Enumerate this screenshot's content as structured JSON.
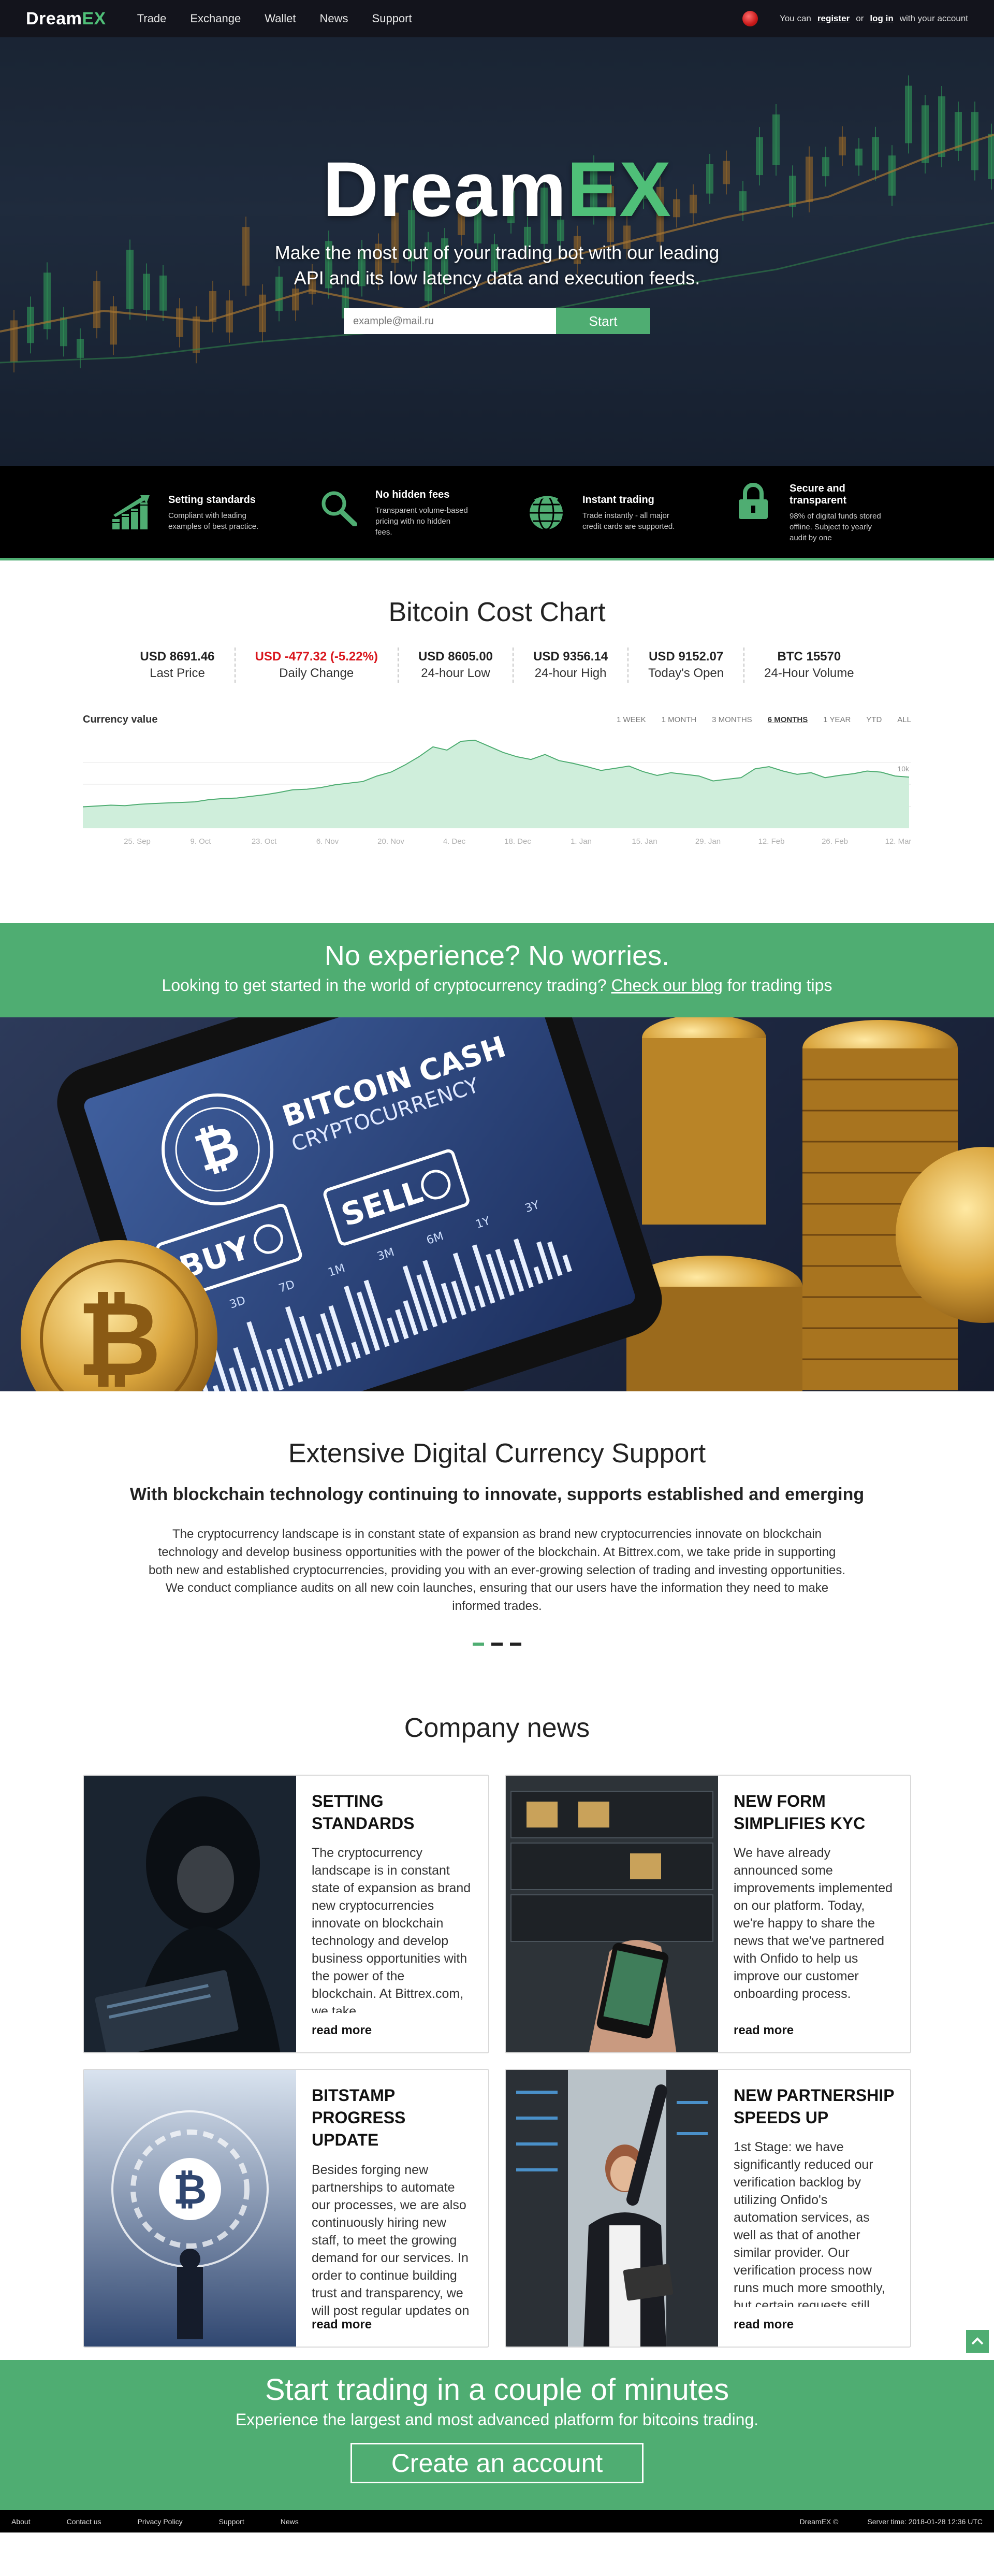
{
  "nav": {
    "logo_main": "Dream",
    "logo_accent": "EX",
    "links": [
      "Trade",
      "Exchange",
      "Wallet",
      "News",
      "Support"
    ],
    "account_prefix": "You can",
    "register": "register",
    "or": "or",
    "login": "log in",
    "account_suffix": "with your account"
  },
  "hero": {
    "title_main": "Dream",
    "title_accent": "EX",
    "subtitle_line1": "Make the most out of your trading bot with our leading",
    "subtitle_line2": "API and its low latency data and execution feeds.",
    "email_placeholder": "example@mail.ru",
    "start_label": "Start"
  },
  "features": [
    {
      "icon": "bar-chart-icon",
      "title": "Setting standards",
      "desc": "Compliant with leading examples of best practice."
    },
    {
      "icon": "search-icon",
      "title": "No hidden fees",
      "desc": "Transparent volume-based pricing with no hidden fees."
    },
    {
      "icon": "globe-icon",
      "title": "Instant trading",
      "desc": "Trade instantly - all major credit cards are supported."
    },
    {
      "icon": "lock-icon",
      "title": "Secure and transparent",
      "desc": "98% of digital funds stored offline. Subject to yearly audit by one"
    }
  ],
  "cost": {
    "title": "Bitcoin Cost Chart",
    "stats": [
      {
        "value": "USD 8691.46",
        "label": "Last Price",
        "negative": false
      },
      {
        "value": "USD -477.32 (-5.22%)",
        "label": "Daily Change",
        "negative": true
      },
      {
        "value": "USD 8605.00",
        "label": "24-hour Low",
        "negative": false
      },
      {
        "value": "USD 9356.14",
        "label": "24-hour High",
        "negative": false
      },
      {
        "value": "USD 9152.07",
        "label": "Today's Open",
        "negative": false
      },
      {
        "value": "BTC 15570",
        "label": "24-Hour Volume",
        "negative": false
      }
    ],
    "chart_title": "Currency value",
    "ranges": [
      "1 WEEK",
      "1 MONTH",
      "3 MONTHS",
      "6 MONTHS",
      "1 YEAR",
      "YTD",
      "ALL"
    ],
    "active_range": "6 MONTHS"
  },
  "chart_data": {
    "type": "area",
    "title": "Currency value",
    "xlabel": "",
    "ylabel": "",
    "x_ticks": [
      "25. Sep",
      "9. Oct",
      "23. Oct",
      "6. Nov",
      "20. Nov",
      "4. Dec",
      "18. Dec",
      "1. Jan",
      "15. Jan",
      "29. Jan",
      "12. Feb",
      "26. Feb",
      "12. Mar"
    ],
    "y_ticks": [
      "10k"
    ],
    "ylim": [
      0,
      16000
    ],
    "values": [
      3900,
      4050,
      4200,
      4100,
      4350,
      4500,
      4600,
      4700,
      4800,
      5200,
      5400,
      5500,
      5800,
      6100,
      6500,
      7000,
      7100,
      7400,
      7900,
      8200,
      8500,
      9500,
      10200,
      11500,
      13000,
      14800,
      14200,
      15800,
      16000,
      14900,
      13800,
      13000,
      12500,
      13400,
      12300,
      11800,
      11200,
      10500,
      10900,
      11300,
      10300,
      9600,
      10100,
      9800,
      9500,
      8600,
      8900,
      9200,
      10800,
      11200,
      10400,
      9800,
      10100,
      9200,
      9600,
      9900,
      10400,
      10200,
      9500,
      9300
    ]
  },
  "promo": {
    "title": "No experience? No worries.",
    "text_before": "Looking to get started in the world of cryptocurrency trading?",
    "link": "Check our blog",
    "text_after": "for trading tips"
  },
  "illustration": {
    "phone_title": "BITCOIN CASH",
    "phone_subtitle": "CRYPTOCURRENCY",
    "buy": "BUY",
    "sell": "SELL",
    "periods": [
      "D",
      "3D",
      "7D",
      "1M",
      "3M",
      "6M",
      "1Y",
      "3Y"
    ]
  },
  "support": {
    "title": "Extensive Digital Currency Support",
    "subtitle": "With blockchain technology continuing to innovate,  supports established and emerging",
    "body": "The cryptocurrency landscape is in constant state of expansion as brand new cryptocurrencies innovate on blockchain technology and develop business opportunities with the power of the blockchain. At Bittrex.com, we take pride in supporting both new and established cryptocurrencies, providing you with an ever-growing selection of trading and investing opportunities. We conduct compliance audits on all new coin launches, ensuring that our users have the information they need to make informed trades."
  },
  "news": {
    "title": "Company news",
    "cards": [
      {
        "title": "Setting standards",
        "text": "The cryptocurrency landscape is in constant state of expansion as brand new cryptocurrencies innovate on blockchain technology and develop business opportunities with the power of the blockchain. At Bittrex.com, we take",
        "more": "read more"
      },
      {
        "title": "New form simplifies KYC",
        "text": "We have already announced some improvements implemented on our platform. Today, we're happy to share the news that we've partnered with Onfido to help us improve our customer onboarding process.",
        "more": "read more"
      },
      {
        "title": "Bitstamp progress update",
        "text": "Besides forging new partnerships to automate our processes, we are also continuously hiring new staff, to meet the growing demand for our services. In order to continue building trust and transparency, we will post regular updates on our progress. Follow us",
        "more": "read more"
      },
      {
        "title": "New partnership speeds up",
        "text": "1st Stage: we have significantly reduced our verification backlog by utilizing Onfido's automation services, as well as that of another similar provider. Our verification process now runs much more smoothly, but certain requests still",
        "more": "read more"
      }
    ]
  },
  "cta": {
    "title": "Start trading in a couple of minutes",
    "subtitle": "Experience the largest and most advanced platform for bitcoins trading.",
    "button": "Create an account"
  },
  "footer": {
    "links": [
      "About",
      "Contact us",
      "Privacy Policy",
      "Support",
      "News"
    ],
    "brand": "DreamEX ©",
    "server_time": "Server time: 2018-01-28 12:36 UTC"
  },
  "colors": {
    "accent": "#4fad72",
    "negative": "#d9161d",
    "dark": "#000000"
  }
}
